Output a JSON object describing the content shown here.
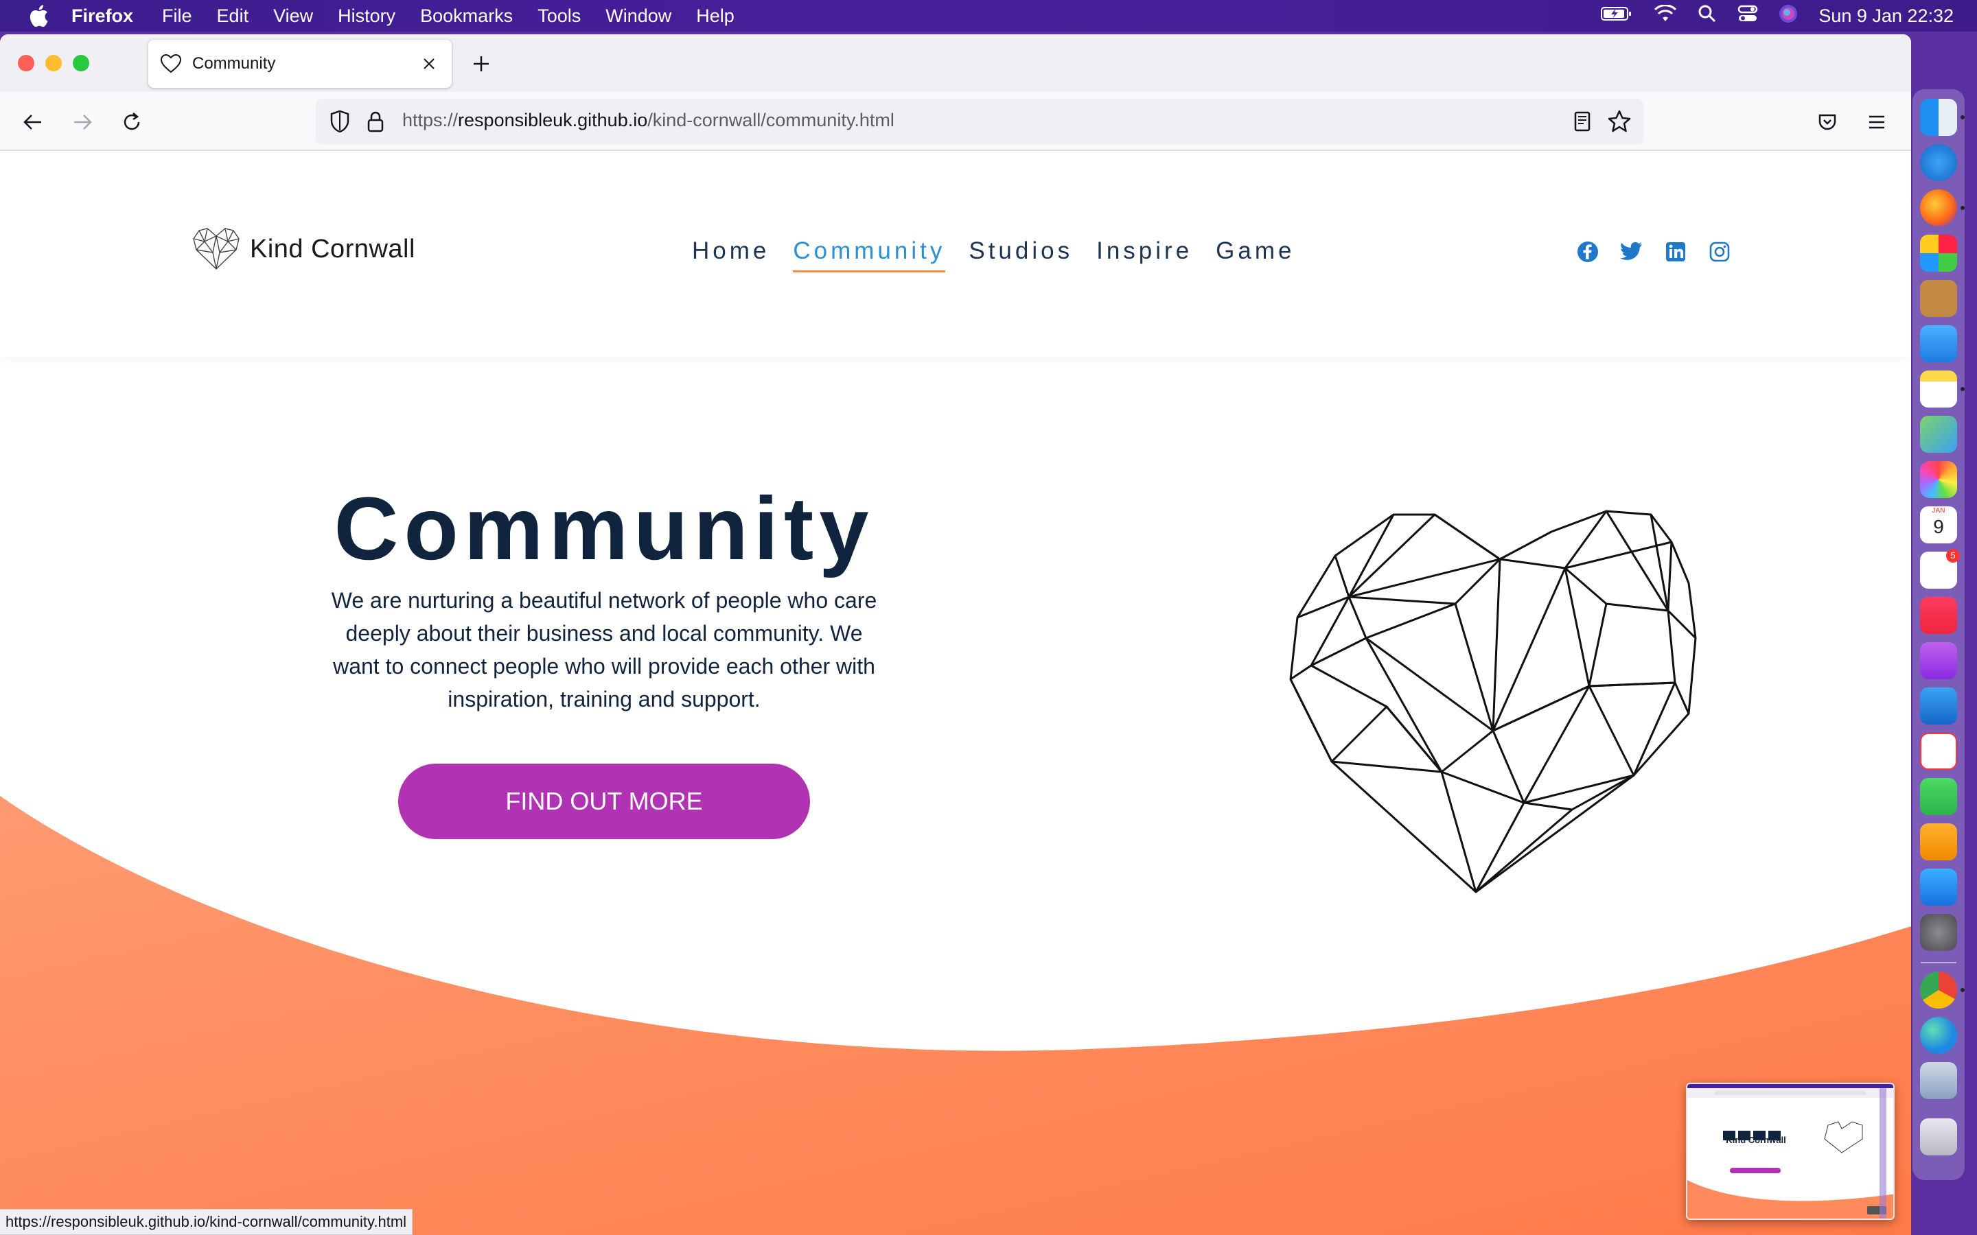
{
  "menubar": {
    "app_name": "Firefox",
    "menus": [
      "File",
      "Edit",
      "View",
      "History",
      "Bookmarks",
      "Tools",
      "Window",
      "Help"
    ],
    "clock": "Sun 9 Jan  22:32"
  },
  "browser": {
    "tab_title": "Community",
    "url_scheme": "https://",
    "url_host": "responsibleuk.github.io",
    "url_path": "/kind-cornwall/community.html",
    "status_url": "https://responsibleuk.github.io/kind-cornwall/community.html"
  },
  "site": {
    "logo_text": "Kind Cornwall",
    "nav": [
      {
        "label": "Home"
      },
      {
        "label": "Community"
      },
      {
        "label": "Studios"
      },
      {
        "label": "Inspire"
      },
      {
        "label": "Game"
      }
    ],
    "active_nav": "Community",
    "social": [
      "facebook-icon",
      "twitter-icon",
      "linkedin-icon",
      "instagram-icon"
    ]
  },
  "hero": {
    "title": "Community",
    "body": "We are nurturing a beautiful network of people who care deeply about their business and local community. We want to connect people who will provide each other with inspiration, training and support.",
    "cta_label": "FIND OUT MORE"
  },
  "thumbnail": {
    "title": "Kind Cornwall"
  },
  "calendar_badge": {
    "month": "JAN",
    "day": "9"
  },
  "reminders_badge": "5",
  "colors": {
    "accent_blue": "#2a8fd4",
    "nav_underline": "#f0913e",
    "cta_purple": "#b033b3",
    "hero_text": "#10243d",
    "wave_orange": "#ff8a5c"
  }
}
